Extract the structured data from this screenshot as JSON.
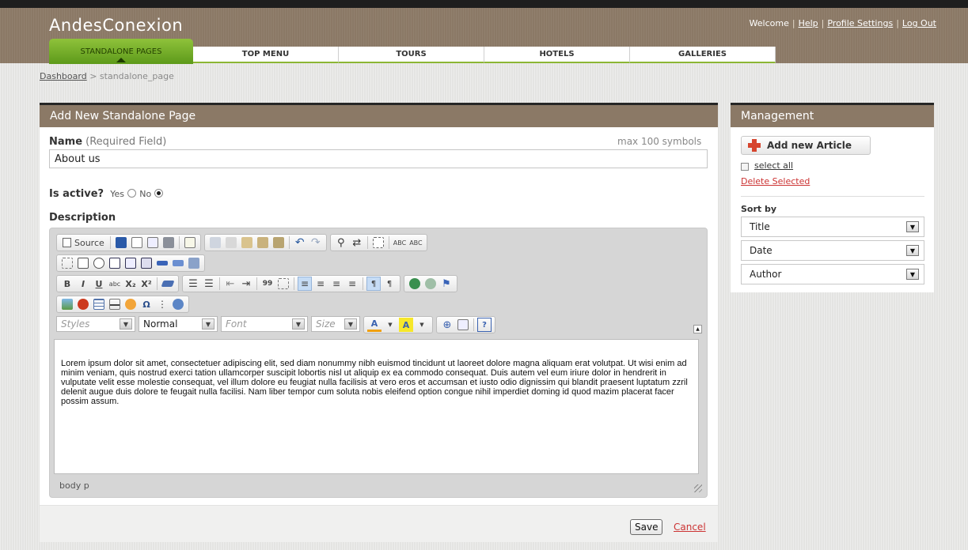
{
  "app": {
    "logo": "AndesConexion",
    "welcome": "Welcome",
    "links": [
      "Help",
      "Profile Settings",
      "Log Out"
    ],
    "separator": "|"
  },
  "nav": {
    "tabs": [
      "STANDALONE PAGES",
      "TOP MENU",
      "TOURS",
      "HOTELS",
      "GALLERIES"
    ],
    "active_index": 0
  },
  "breadcrumb": {
    "root": "Dashboard",
    "separator": ">",
    "current": "standalone_page"
  },
  "form": {
    "title": "Add New Standalone Page",
    "name_label": "Name",
    "name_hint": "(Required Field)",
    "name_max": "max 100 symbols",
    "name_value": "About us",
    "active_label": "Is active?",
    "yes_label": "Yes",
    "no_label": "No",
    "active_selected": "No",
    "description_label": "Description",
    "description_text": "Lorem ipsum dolor sit amet, consectetuer adipiscing elit, sed diam nonummy nibh euismod tincidunt ut laoreet dolore magna aliquam erat volutpat. Ut wisi enim ad minim veniam, quis nostrud exerci tation ullamcorper suscipit lobortis nisl ut aliquip ex ea commodo consequat. Duis autem vel eum iriure dolor in hendrerit in vulputate velit esse molestie consequat, vel illum dolore eu feugiat nulla facilisis at vero eros et accumsan et iusto odio dignissim qui blandit praesent luptatum zzril delenit augue duis dolore te feugait nulla facilisi. Nam liber tempor cum soluta nobis eleifend option congue nihil imperdiet doming id quod mazim placerat facer possim assum.",
    "save_label": "Save",
    "cancel_label": "Cancel"
  },
  "editor": {
    "source_label": "Source",
    "styles_placeholder": "Styles",
    "format_value": "Normal",
    "font_placeholder": "Font",
    "size_placeholder": "Size",
    "path": "body  p",
    "glyphs": {
      "bold": "B",
      "italic": "I",
      "underline": "U",
      "strike": "abc",
      "sub": "X₂",
      "sup": "X²",
      "quote": "99",
      "omega": "Ω",
      "help": "?",
      "spell1": "ABC",
      "spell2": "ABC"
    }
  },
  "management": {
    "title": "Management",
    "add_label": "Add new Article",
    "select_all": "select all",
    "delete_selected": "Delete Selected",
    "sort_label": "Sort by",
    "sort_options": [
      "Title",
      "Date",
      "Author"
    ]
  },
  "colors": {
    "header_brown": "#8b7966",
    "nav_green": "#6aab26",
    "link_red": "#cc3333"
  }
}
